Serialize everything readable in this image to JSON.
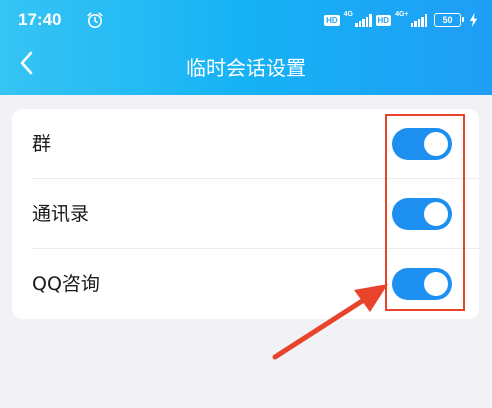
{
  "status_bar": {
    "time": "17:40",
    "hd1": "HD",
    "net1": "4G",
    "hd2": "HD",
    "net2": "4G+",
    "battery": "50"
  },
  "header": {
    "title": "临时会话设置"
  },
  "settings": {
    "items": [
      {
        "label": "群",
        "enabled": true
      },
      {
        "label": "通讯录",
        "enabled": true
      },
      {
        "label": "QQ咨询",
        "enabled": true
      }
    ]
  },
  "colors": {
    "header_start": "#36c4f4",
    "header_end": "#1f9ef5",
    "toggle_on": "#1d8ff0",
    "annotation": "#e8432b",
    "background": "#f2f2f6"
  },
  "icons": {
    "back": "chevron-left-icon",
    "alarm": "alarm-clock-icon",
    "charging": "lightning-bolt-icon"
  }
}
